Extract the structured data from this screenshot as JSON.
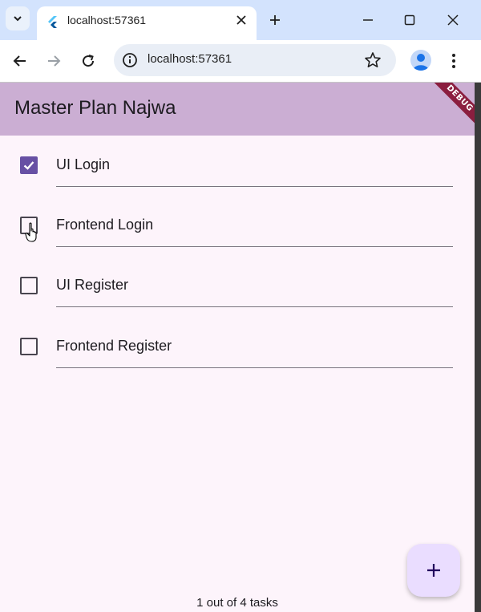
{
  "browser": {
    "tab_title": "localhost:57361",
    "address": "localhost:57361"
  },
  "app": {
    "title": "Master Plan Najwa",
    "debug_banner": "DEBUG",
    "tasks": [
      {
        "label": "UI Login",
        "checked": true
      },
      {
        "label": "Frontend Login",
        "checked": false
      },
      {
        "label": "UI Register",
        "checked": false
      },
      {
        "label": "Frontend Register",
        "checked": false
      }
    ],
    "fab_icon": "add-icon",
    "footer_text": "1 out of 4 tasks"
  },
  "colors": {
    "appbar": "#cbaed3",
    "checkbox_checked": "#6750a4",
    "fab": "#eaddff",
    "background": "#fdf4fb"
  }
}
